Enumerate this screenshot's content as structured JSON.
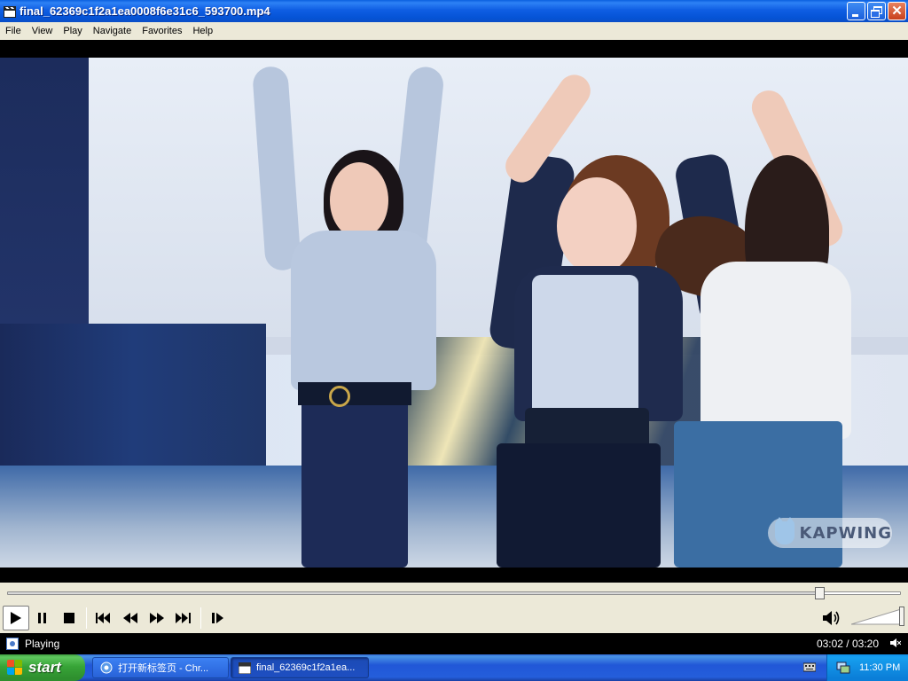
{
  "window": {
    "title": "final_62369c1f2a1ea0008f6e31c6_593700.mp4",
    "icon": "clapperboard-icon"
  },
  "menu": {
    "items": [
      "File",
      "View",
      "Play",
      "Navigate",
      "Favorites",
      "Help"
    ]
  },
  "video": {
    "watermark": "KAPWING"
  },
  "seek": {
    "position_fraction": 0.91
  },
  "controls": {
    "buttons": [
      "play-icon",
      "pause-icon",
      "stop-icon",
      "skip-back-icon",
      "rewind-icon",
      "fast-forward-icon",
      "skip-forward-icon",
      "frame-step-icon"
    ],
    "volume_fraction": 1.0
  },
  "status": {
    "text": "Playing",
    "time": "03:02 / 03:20"
  },
  "taskbar": {
    "start_label": "start",
    "tasks": [
      {
        "label": "打开新标签页 - Chr...",
        "active": false,
        "icon": "chrome-icon"
      },
      {
        "label": "final_62369c1f2a1ea...",
        "active": true,
        "icon": "clapperboard-icon"
      }
    ],
    "clock": "11:30 PM"
  },
  "colors": {
    "xp_blue": "#0553d6",
    "start_green": "#37a437",
    "chrome_bg": "#ece9d8"
  }
}
